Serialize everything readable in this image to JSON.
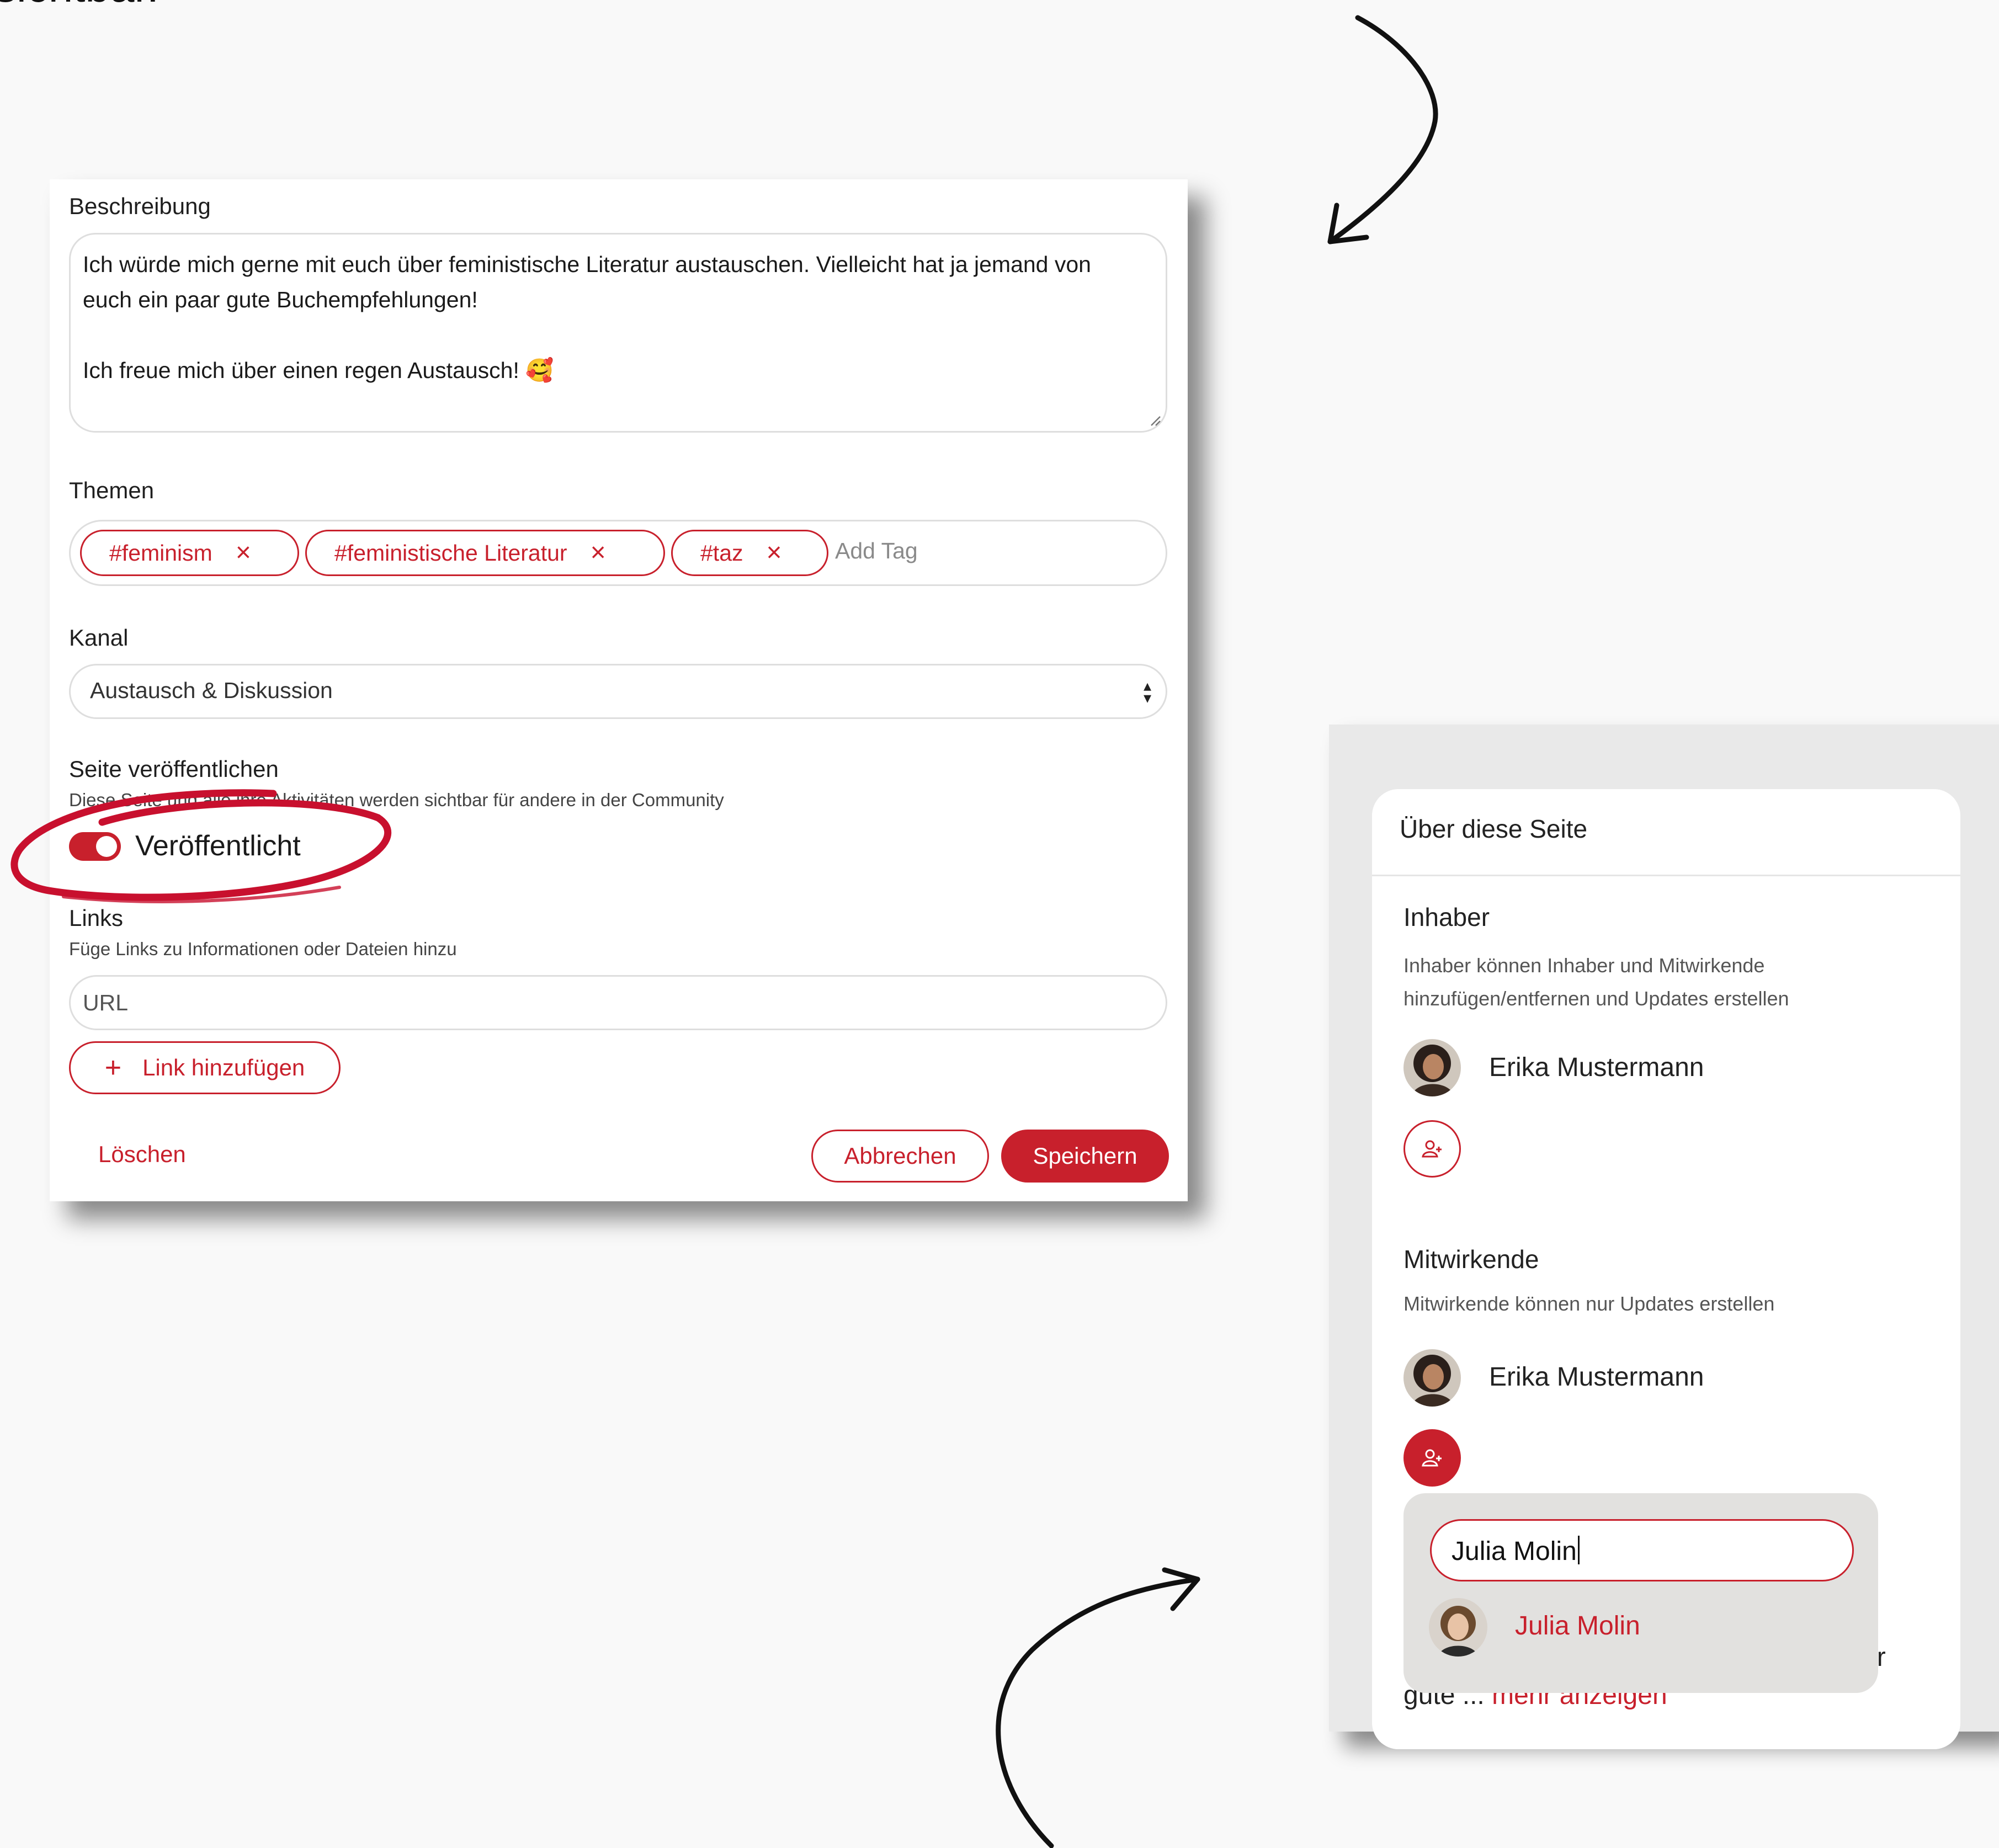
{
  "caption": {
    "partial_text": "sichtbar."
  },
  "edit_form": {
    "description": {
      "label": "Beschreibung",
      "line1": "Ich würde mich gerne mit euch über feministische Literatur austauschen. Vielleicht hat ja jemand von",
      "line2": "euch ein paar gute Buchempfehlungen!",
      "line3": "Ich freue mich über einen regen Austausch! 🥰"
    },
    "topics": {
      "label": "Themen",
      "tags": [
        "#feminism",
        "#feministische Literatur",
        "#taz"
      ],
      "remove_glyph": "×",
      "add_placeholder": "Add Tag"
    },
    "channel": {
      "label": "Kanal",
      "selected": "Austausch & Diskussion"
    },
    "publish": {
      "label": "Seite veröffentlichen",
      "hint": "Diese Seite und alle ihre Aktivitäten werden sichtbar für andere in der Community",
      "toggle_label": "Veröffentlicht",
      "toggle_on": true
    },
    "links": {
      "label": "Links",
      "hint": "Füge Links zu Informationen oder Dateien hinzu",
      "url_placeholder": "URL",
      "add_button": "Link hinzufügen",
      "add_glyph": "+"
    },
    "actions": {
      "delete": "Löschen",
      "cancel": "Abbrechen",
      "save": "Speichern"
    }
  },
  "about_panel": {
    "title": "Über diese Seite",
    "owners": {
      "heading": "Inhaber",
      "desc_line1": "Inhaber können Inhaber und Mitwirkende",
      "desc_line2": "hinzufügen/entfernen und Updates erstellen",
      "members": [
        "Erika Mustermann"
      ]
    },
    "contributors": {
      "heading": "Mitwirkende",
      "desc": "Mitwirkende können nur Updates erstellen",
      "members": [
        "Erika Mustermann"
      ]
    },
    "search": {
      "value": "Julia Molin",
      "results": [
        "Julia Molin"
      ]
    },
    "behind_text": {
      "line_end": "ar",
      "truncated": "gute ...",
      "more_link": "mehr anzeigen"
    }
  },
  "colors": {
    "accent": "#c8202c",
    "annotation_circle": "#c8102e",
    "arrow": "#111111"
  }
}
